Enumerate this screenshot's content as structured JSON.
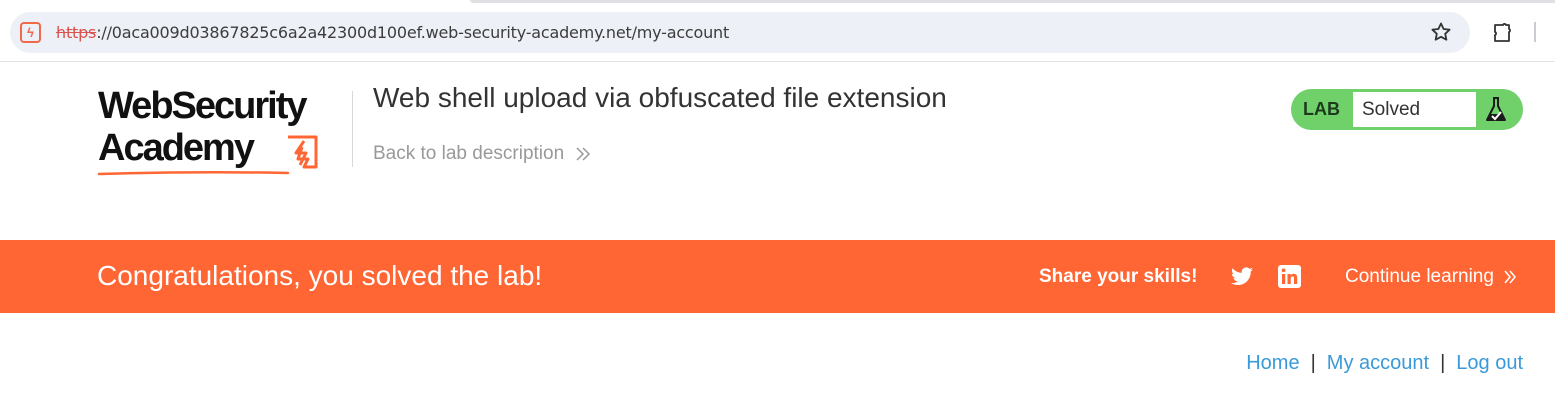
{
  "browser": {
    "url_scheme": "https",
    "url_rest": "://0aca009d03867825c6a2a42300d100ef.web-security-academy.net/my-account",
    "site_icon": "portswigger-bolt-icon",
    "bookmark_icon": "star-icon",
    "extensions_icon": "puzzle-icon"
  },
  "header": {
    "logo_line1": "WebSecurity",
    "logo_line2": "Academy",
    "lab_title": "Web shell upload via obfuscated file extension",
    "back_link": "Back to lab description",
    "lab_status": {
      "label": "LAB",
      "value": "Solved",
      "icon": "flask-icon"
    }
  },
  "banner": {
    "message": "Congratulations, you solved the lab!",
    "share_label": "Share your skills!",
    "twitter_icon": "twitter-icon",
    "linkedin_icon": "linkedin-icon",
    "continue_link": "Continue learning"
  },
  "nav": {
    "home": "Home",
    "my_account": "My account",
    "log_out": "Log out",
    "separator": "|"
  },
  "colors": {
    "brand_orange": "#ff6633",
    "status_green": "#70d16b",
    "link_blue": "#3a9ad9"
  }
}
